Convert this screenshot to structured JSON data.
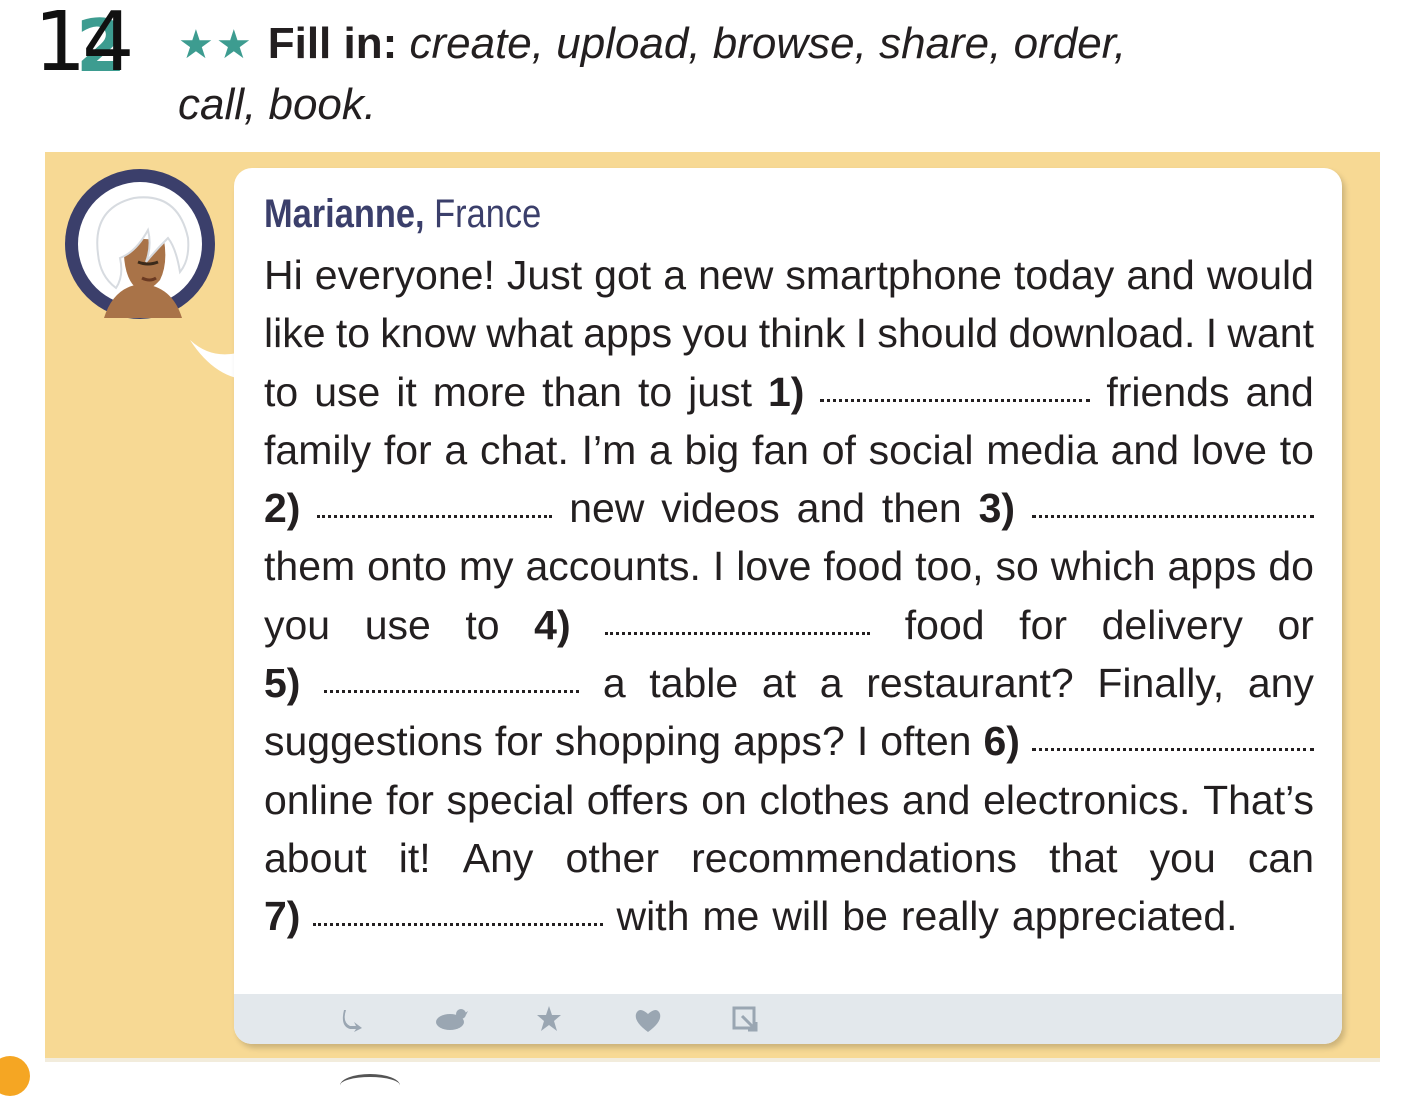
{
  "exercise": {
    "printed_number": "2",
    "handwritten_number": "14",
    "stars": "★★",
    "lead": "Fill in:",
    "words_line1": "create, upload, browse, share, order,",
    "words_line2": "call, book."
  },
  "post": {
    "author_name": "Marianne,",
    "author_country": "France",
    "lines": [
      {
        "align": "justify",
        "segs": [
          {
            "t": "Hi"
          },
          {
            "t": "everyone!"
          },
          {
            "t": "Just"
          },
          {
            "t": "got"
          },
          {
            "t": "a"
          },
          {
            "t": "new"
          },
          {
            "t": "smartphone"
          },
          {
            "t": "today"
          },
          {
            "t": "and"
          },
          {
            "t": "would"
          }
        ]
      },
      {
        "align": "justify",
        "segs": [
          {
            "t": "like"
          },
          {
            "t": "to"
          },
          {
            "t": "know"
          },
          {
            "t": "what"
          },
          {
            "t": "apps"
          },
          {
            "t": "you"
          },
          {
            "t": "think"
          },
          {
            "t": "I"
          },
          {
            "t": "should"
          },
          {
            "t": "download."
          },
          {
            "t": "I"
          },
          {
            "t": "want"
          }
        ]
      },
      {
        "align": "justify",
        "segs": [
          {
            "t": "to"
          },
          {
            "t": "use"
          },
          {
            "t": "it"
          },
          {
            "t": "more"
          },
          {
            "t": "than"
          },
          {
            "t": "to"
          },
          {
            "t": "just"
          },
          {
            "t": "1)",
            "b": 1
          },
          {
            "blank": 270
          },
          {
            "t": "friends"
          },
          {
            "t": "and"
          }
        ]
      },
      {
        "align": "justify",
        "segs": [
          {
            "t": "family"
          },
          {
            "t": "for"
          },
          {
            "t": "a"
          },
          {
            "t": "chat."
          },
          {
            "t": "I’m"
          },
          {
            "t": "a"
          },
          {
            "t": "big"
          },
          {
            "t": "fan"
          },
          {
            "t": "of"
          },
          {
            "t": "social"
          },
          {
            "t": "media"
          },
          {
            "t": "and"
          },
          {
            "t": "love"
          },
          {
            "t": "to"
          }
        ]
      },
      {
        "align": "justify",
        "segs": [
          {
            "t": "2)",
            "b": 1
          },
          {
            "blank": 235
          },
          {
            "t": "new"
          },
          {
            "t": "videos"
          },
          {
            "t": "and"
          },
          {
            "t": "then"
          },
          {
            "t": "3)",
            "b": 1
          },
          {
            "blank": 282
          }
        ]
      },
      {
        "align": "justify",
        "segs": [
          {
            "t": "them"
          },
          {
            "t": "onto"
          },
          {
            "t": "my"
          },
          {
            "t": "accounts."
          },
          {
            "t": "I"
          },
          {
            "t": "love"
          },
          {
            "t": "food"
          },
          {
            "t": "too,"
          },
          {
            "t": "so"
          },
          {
            "t": "which"
          },
          {
            "t": "apps"
          },
          {
            "t": "do"
          }
        ]
      },
      {
        "align": "justify",
        "segs": [
          {
            "t": "you"
          },
          {
            "t": "use"
          },
          {
            "t": "to"
          },
          {
            "t": "4)",
            "b": 1
          },
          {
            "blank": 265
          },
          {
            "t": "food"
          },
          {
            "t": "for"
          },
          {
            "t": "delivery"
          },
          {
            "t": "or"
          }
        ]
      },
      {
        "align": "justify",
        "segs": [
          {
            "t": "5)",
            "b": 1
          },
          {
            "blank": 255
          },
          {
            "t": "a"
          },
          {
            "t": "table"
          },
          {
            "t": "at"
          },
          {
            "t": "a"
          },
          {
            "t": "restaurant?"
          },
          {
            "t": "Finally,"
          },
          {
            "t": "any"
          }
        ]
      },
      {
        "align": "justify",
        "segs": [
          {
            "t": "suggestions"
          },
          {
            "t": "for"
          },
          {
            "t": "shopping"
          },
          {
            "t": "apps?"
          },
          {
            "t": "I"
          },
          {
            "t": "often"
          },
          {
            "t": "6)",
            "b": 1
          },
          {
            "blank": 282
          }
        ]
      },
      {
        "align": "justify",
        "segs": [
          {
            "t": "online"
          },
          {
            "t": "for"
          },
          {
            "t": "special"
          },
          {
            "t": "offers"
          },
          {
            "t": "on"
          },
          {
            "t": "clothes"
          },
          {
            "t": "and"
          },
          {
            "t": "electronics."
          },
          {
            "t": "That’s"
          }
        ]
      },
      {
        "align": "justify",
        "segs": [
          {
            "t": "about"
          },
          {
            "t": "it!"
          },
          {
            "t": "Any"
          },
          {
            "t": "other"
          },
          {
            "t": "recommendations"
          },
          {
            "t": "that"
          },
          {
            "t": "you"
          },
          {
            "t": "can"
          }
        ]
      },
      {
        "align": "left",
        "segs": [
          {
            "t": "7)",
            "b": 1
          },
          {
            "blank": 290
          },
          {
            "t": "with"
          },
          {
            "t": "me"
          },
          {
            "t": "will"
          },
          {
            "t": "be"
          },
          {
            "t": "really"
          },
          {
            "t": "appreciated."
          }
        ]
      }
    ]
  },
  "toolbar_icons": [
    "reply-icon",
    "bird-icon",
    "star-icon",
    "heart-icon",
    "share-icon"
  ],
  "colors": {
    "panel": "#f7d994",
    "accent": "#3d9c90",
    "author": "#3b3f6b",
    "toolbar": "#e3e8ec",
    "icon": "#9aa6b2"
  }
}
